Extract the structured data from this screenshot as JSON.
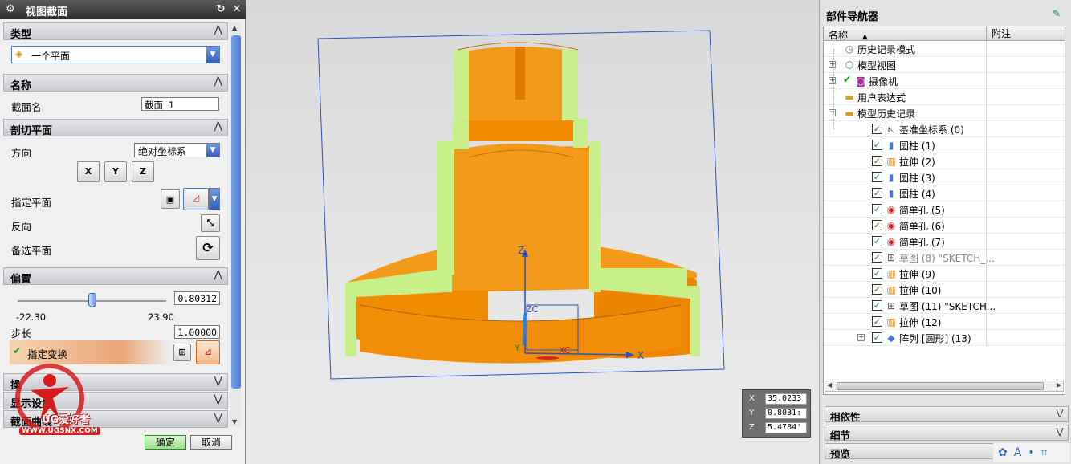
{
  "dialog": {
    "title": "视图截面",
    "sections": {
      "type": "类型",
      "name": "名称",
      "cut_plane": "剖切平面",
      "offset": "偏置",
      "collapsed_1": "操",
      "collapsed_2": "显示设置",
      "collapsed_3": "截面曲线"
    },
    "type_value": "一个平面",
    "section_name_label": "截面名",
    "section_name_value": "截面 1",
    "direction_label": "方向",
    "direction_value": "绝对坐标系",
    "specify_plane_label": "指定平面",
    "reverse_label": "反向",
    "alternate_plane_label": "备选平面",
    "offset_value": "0.80312",
    "slider_min": "-22.30",
    "slider_max": "23.90",
    "slider_fraction": 0.5,
    "step_label": "步长",
    "step_value": "1.00000",
    "specify_transform_label": "指定变换",
    "ok_label": "确定",
    "cancel_label": "取消",
    "axis_buttons": [
      "X",
      "Y",
      "Z"
    ]
  },
  "viewport": {
    "axes": {
      "x": "X",
      "y": "Y",
      "z": "Z",
      "xc": "XC",
      "zc": "ZC",
      "yc": "Y"
    },
    "coords": {
      "x_label": "X",
      "y_label": "Y",
      "z_label": "Z",
      "x": "35.0233",
      "y": "0.8031:",
      "z": "5.4784'"
    }
  },
  "navigator": {
    "title": "部件导航器",
    "col_name": "名称",
    "col_note": "附注",
    "items": [
      {
        "label": "历史记录模式",
        "icon": "clock-icon"
      },
      {
        "label": "模型视图",
        "icon": "model-views-icon"
      },
      {
        "label": "摄像机",
        "icon": "camera-icon"
      },
      {
        "label": "用户表达式",
        "icon": "folder-icon"
      },
      {
        "label": "模型历史记录",
        "icon": "folder-open-icon"
      },
      {
        "label": "基准坐标系 (0)",
        "icon": "datum-csys-icon"
      },
      {
        "label": "圆柱 (1)",
        "icon": "cylinder-icon"
      },
      {
        "label": "拉伸 (2)",
        "icon": "extrude-icon"
      },
      {
        "label": "圆柱 (3)",
        "icon": "cylinder-icon"
      },
      {
        "label": "圆柱 (4)",
        "icon": "cylinder-icon"
      },
      {
        "label": "简单孔 (5)",
        "icon": "hole-icon"
      },
      {
        "label": "简单孔 (6)",
        "icon": "hole-icon"
      },
      {
        "label": "简单孔 (7)",
        "icon": "hole-icon"
      },
      {
        "label": "草图 (8) \"SKETCH_...",
        "icon": "sketch-icon"
      },
      {
        "label": "拉伸 (9)",
        "icon": "extrude-icon"
      },
      {
        "label": "拉伸 (10)",
        "icon": "extrude-icon"
      },
      {
        "label": "草图 (11) \"SKETCH...",
        "icon": "sketch-icon"
      },
      {
        "label": "拉伸 (12)",
        "icon": "extrude-icon"
      },
      {
        "label": "阵列 [圆形] (13)",
        "icon": "pattern-icon"
      }
    ],
    "panels": [
      "相依性",
      "细节",
      "预览"
    ]
  },
  "watermark": {
    "text": "UG爱好者",
    "url": "WWW.UGSNX.COM"
  },
  "colors": {
    "part": "#f28a00",
    "cut_face": "#c7ef8a",
    "selection": "#2c4fbf"
  }
}
